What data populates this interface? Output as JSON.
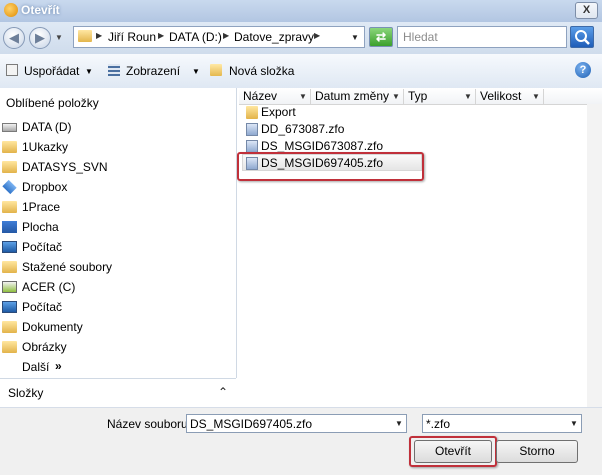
{
  "window": {
    "title": "Otevřít",
    "close_label": "X"
  },
  "address": {
    "breadcrumb": [
      "Jiří Roun",
      "DATA (D:)",
      "Datove_zpravy"
    ],
    "search_placeholder": "Hledat"
  },
  "toolbar": {
    "organize_label": "Uspořádat",
    "views_label": "Zobrazení",
    "new_folder_label": "Nová složka"
  },
  "nav": {
    "favorites_header": "Oblíbené položky",
    "items": [
      {
        "label": "DATA (D)",
        "icon": "drive-icon"
      },
      {
        "label": "1Ukazky",
        "icon": "folder-icon"
      },
      {
        "label": "DATASYS_SVN",
        "icon": "folder-icon"
      },
      {
        "label": "Dropbox",
        "icon": "dropbox-icon"
      },
      {
        "label": "1Prace",
        "icon": "folder-icon"
      },
      {
        "label": "Plocha",
        "icon": "desktop-icon"
      },
      {
        "label": "Počítač",
        "icon": "computer-icon"
      },
      {
        "label": "Stažené soubory",
        "icon": "folder-icon"
      },
      {
        "label": "ACER (C)",
        "icon": "windows-drive-icon"
      },
      {
        "label": "Počítač",
        "icon": "computer-icon"
      },
      {
        "label": "Dokumenty",
        "icon": "folder-icon"
      },
      {
        "label": "Obrázky",
        "icon": "folder-icon"
      }
    ],
    "more_label": "Další",
    "folders_label": "Složky"
  },
  "file_list": {
    "columns": [
      "Název",
      "Datum změny",
      "Typ",
      "Velikost"
    ],
    "files": [
      {
        "name": "Export",
        "icon": "folder-icon"
      },
      {
        "name": "DD_673087.zfo",
        "icon": "zfo-file-icon"
      },
      {
        "name": "DS_MSGID673087.zfo",
        "icon": "zfo-file-icon"
      },
      {
        "name": "DS_MSGID697405.zfo",
        "icon": "zfo-file-icon",
        "selected": true
      }
    ]
  },
  "bottom": {
    "filename_label": "Název souboru:",
    "filename_value": "DS_MSGID697405.zfo",
    "filetype_value": "*.zfo",
    "open_label": "Otevřít",
    "cancel_label": "Storno"
  },
  "colors": {
    "highlight": "#c0303a",
    "accent": "#1e5db8"
  }
}
